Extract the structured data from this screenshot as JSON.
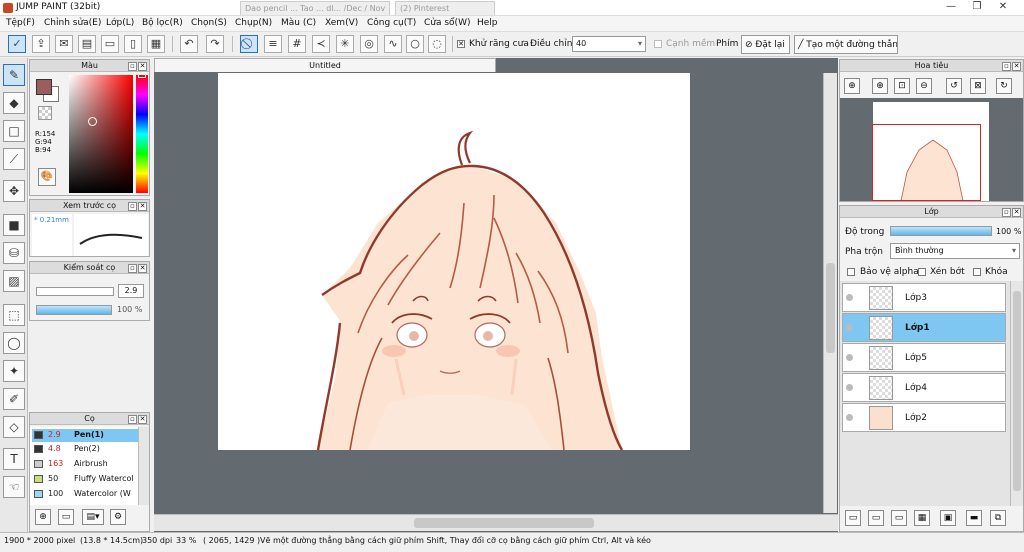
{
  "window": {
    "title": "JUMP PAINT (32bit)",
    "ghost_tab_1": "Dao pencil ... Tao ... dl... /Dec / Nov",
    "ghost_tab_2": "(2) Pinterest",
    "min": "—",
    "max": "❐",
    "close": "✕"
  },
  "menu": [
    "Tệp(F)",
    "Chỉnh sửa(E)",
    "Lớp(L)",
    "Bộ lọc(R)",
    "Chọn(S)",
    "Chụp(N)",
    "Màu (C)",
    "Xem(V)",
    "Công cụ(T)",
    "Cửa sổ(W)",
    "Help"
  ],
  "toolbar": {
    "antialias_label": "Khử răng cưa",
    "antialias_checked": "✕",
    "adjust_label": "Điều chỉnh",
    "adjust_value": "40",
    "edge_label": "Cạnh mềm",
    "key_label": "Phím",
    "reset_label": "Đặt lại",
    "straight_label": "Tạo một đường thẳng"
  },
  "color_panel": {
    "title": "Màu",
    "r": "R:154",
    "g": "G:94",
    "b": "B:94",
    "primary": "#9a5e5e"
  },
  "preview_panel": {
    "title": "Xem trước cọ",
    "size": "* 0.21mm"
  },
  "brush_control": {
    "title": "Kiểm soát cọ",
    "size_value": "2.9",
    "opacity_value": "100 %",
    "opacity_fraction": 1.0
  },
  "brush_panel": {
    "title": "Cọ",
    "items": [
      {
        "size": "2.9",
        "name": "Pen(1)",
        "color": "#333333",
        "size_color": "#cc2222",
        "selected": true
      },
      {
        "size": "4.8",
        "name": "Pen(2)",
        "color": "#333333",
        "size_color": "#cc2222",
        "selected": false
      },
      {
        "size": "163",
        "name": "Airbrush",
        "color": "#cccccc",
        "size_color": "#cc2222",
        "selected": false
      },
      {
        "size": "50",
        "name": "Fluffy Watercol",
        "color": "#c8e07a",
        "size_color": "#222222",
        "selected": false
      },
      {
        "size": "100",
        "name": "Watercolor (W",
        "color": "#9ad8f0",
        "size_color": "#222222",
        "selected": false
      }
    ]
  },
  "canvas": {
    "tab_title": "Untitled"
  },
  "navigator": {
    "title": "Hoa tiêu"
  },
  "layers": {
    "title": "Lớp",
    "opacity_label": "Độ trong",
    "opacity_value": "100 %",
    "opacity_fraction": 1.0,
    "blend_label": "Pha trộn",
    "blend_value": "Bình thường",
    "protect_alpha": "Bảo vệ alpha",
    "clip": "Xén bớt",
    "lock": "Khóa",
    "items": [
      {
        "name": "Lớp3",
        "selected": false
      },
      {
        "name": "Lớp1",
        "selected": true
      },
      {
        "name": "Lớp5",
        "selected": false
      },
      {
        "name": "Lớp4",
        "selected": false
      },
      {
        "name": "Lớp2",
        "selected": false
      }
    ]
  },
  "status": {
    "size": "1900 * 2000 pixel",
    "cm": "(13.8 * 14.5cm)",
    "dpi": "350 dpi",
    "zoom": "33 %",
    "coords": "( 2065, 1429 )",
    "hint": "Vẽ một đường thẳng bằng cách giữ phím Shift, Thay đổi cỡ cọ bằng cách giữ phím Ctrl, Alt và kéo"
  }
}
